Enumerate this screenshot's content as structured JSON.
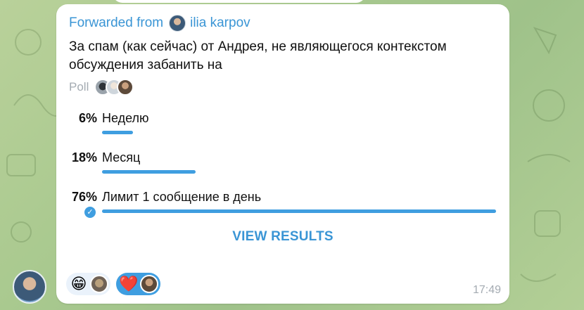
{
  "message": {
    "forwarded_prefix": "Forwarded from",
    "forwarded_name": "ilia karpov",
    "question": "За спам (как сейчас) от Андрея, не являющегося контекстом обсуждения забанить на",
    "poll_label": "Poll",
    "options": [
      {
        "percent": "6%",
        "label": "Неделю",
        "value": 6,
        "chosen": false
      },
      {
        "percent": "18%",
        "label": "Месяц",
        "value": 18,
        "chosen": false
      },
      {
        "percent": "76%",
        "label": "Лимит 1 сообщение в день",
        "value": 76,
        "chosen": true
      }
    ],
    "view_results": "VIEW RESULTS",
    "time": "17:49",
    "reactions": [
      {
        "emoji": "😁",
        "active": false
      },
      {
        "emoji": "❤️",
        "active": true
      }
    ]
  },
  "colors": {
    "accent": "#3a95d5",
    "bar": "#3f9ee0",
    "bubble": "#ffffff",
    "muted": "#a4abb2"
  }
}
